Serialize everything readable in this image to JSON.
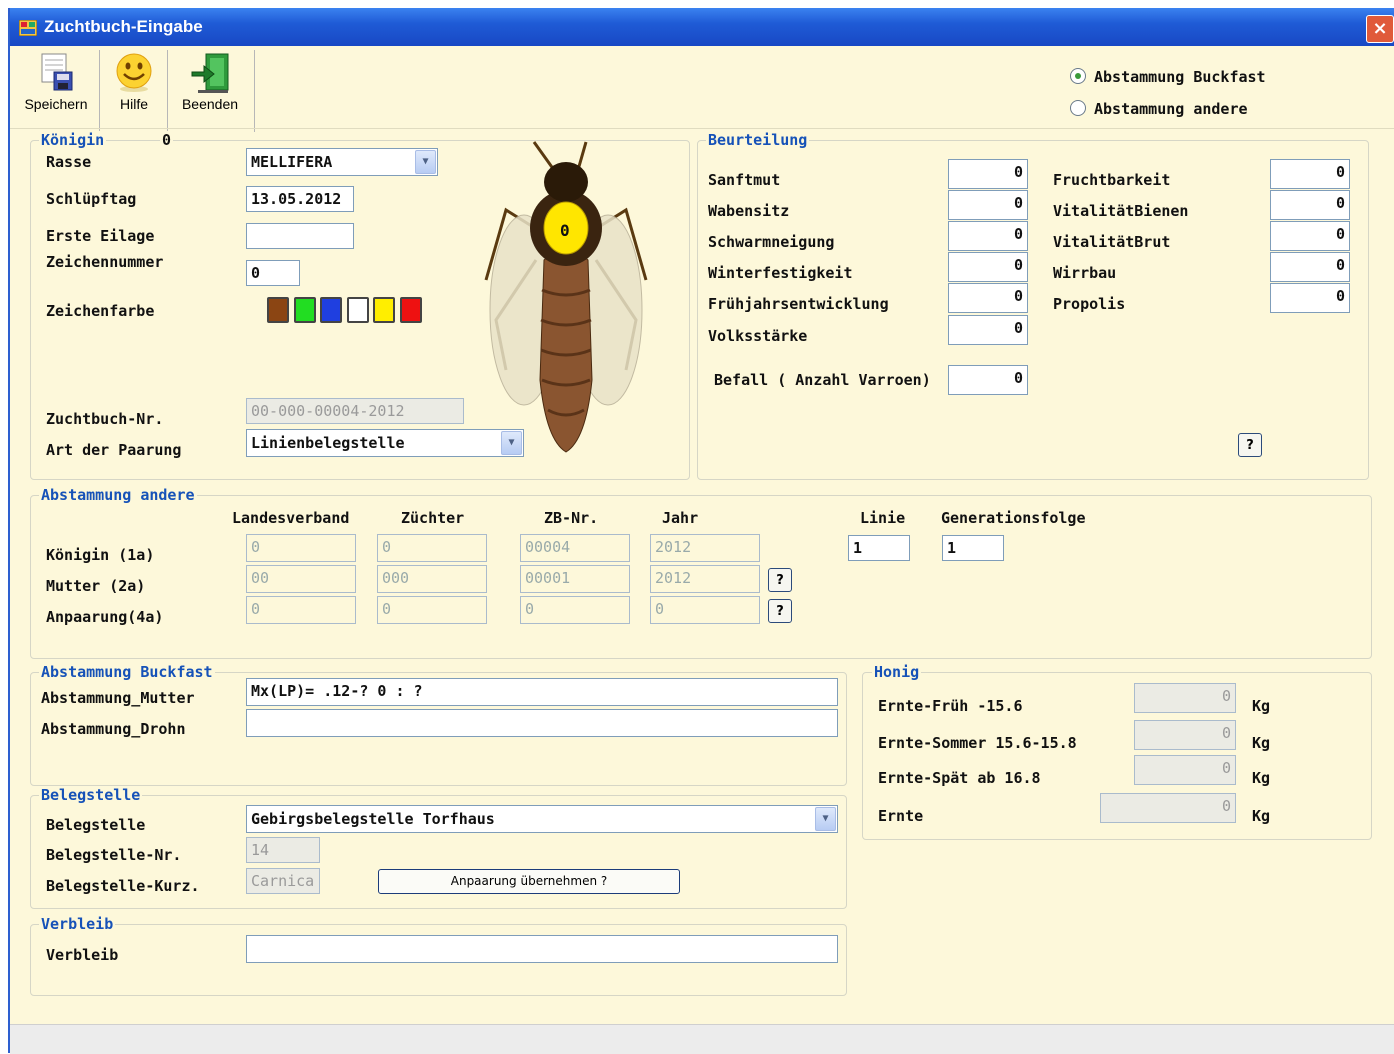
{
  "window": {
    "title": "Zuchtbuch-Eingabe",
    "close": "×"
  },
  "toolbar": {
    "save": "Speichern",
    "help": "Hilfe",
    "exit": "Beenden"
  },
  "abstammung_radio": {
    "buckfast": "Abstammung Buckfast",
    "andere": "Abstammung andere",
    "selected": "buckfast"
  },
  "koenigin": {
    "title": "Königin",
    "count": "0",
    "rasse_label": "Rasse",
    "rasse_value": "MELLIFERA",
    "schluepftag_label": "Schlüpftag",
    "schluepftag_value": "13.05.2012",
    "erste_eilage_label": "Erste Eilage",
    "erste_eilage_value": "",
    "zeichennummer_label": "Zeichennummer",
    "zeichennummer_value": "0",
    "zeichenfarbe_label": "Zeichenfarbe",
    "colors": [
      "#8b4513",
      "#22dd22",
      "#1f3fe0",
      "#ffffff",
      "#ffee00",
      "#ee1111"
    ],
    "zuchtbuch_label": "Zuchtbuch-Nr.",
    "zuchtbuch_value": "00-000-00004-2012",
    "paarung_label": "Art der Paarung",
    "paarung_value": "Linienbelegstelle",
    "bee_mark": "0"
  },
  "beurteilung": {
    "title": "Beurteilung",
    "left": [
      {
        "label": "Sanftmut",
        "value": "0"
      },
      {
        "label": "Wabensitz",
        "value": "0"
      },
      {
        "label": "Schwarmneigung",
        "value": "0"
      },
      {
        "label": "Winterfestigkeit",
        "value": "0"
      },
      {
        "label": "Frühjahrsentwicklung",
        "value": "0"
      },
      {
        "label": "Volksstärke",
        "value": "0"
      }
    ],
    "right": [
      {
        "label": "Fruchtbarkeit",
        "value": "0"
      },
      {
        "label": "VitalitätBienen",
        "value": "0"
      },
      {
        "label": "VitalitätBrut",
        "value": "0"
      },
      {
        "label": "Wirrbau",
        "value": "0"
      },
      {
        "label": "Propolis",
        "value": "0"
      }
    ],
    "befall_label": "Befall ( Anzahl Varroen)",
    "befall_value": "0",
    "help": "?"
  },
  "andere": {
    "title": "Abstammung andere",
    "headers": [
      "Landesverband",
      "Züchter",
      "ZB-Nr.",
      "Jahr",
      "Linie",
      "Generationsfolge"
    ],
    "rows": [
      {
        "label": "Königin (1a)",
        "values": [
          "0",
          "0",
          "00004",
          "2012"
        ]
      },
      {
        "label": "Mutter (2a)",
        "values": [
          "00",
          "000",
          "00001",
          "2012"
        ]
      },
      {
        "label": "Anpaarung(4a)",
        "values": [
          "0",
          "0",
          "0",
          "0"
        ]
      }
    ],
    "linie": "1",
    "generationsfolge": "1",
    "help": "?"
  },
  "buckfast": {
    "title": "Abstammung Buckfast",
    "mutter_label": "Abstammung_Mutter",
    "mutter_value": "Mx(LP)= .12-? 0 : ?",
    "drohn_label": "Abstammung_Drohn",
    "drohn_value": ""
  },
  "honig": {
    "title": "Honig",
    "rows": [
      {
        "label": "Ernte-Früh -15.6",
        "value": "0",
        "unit": "Kg"
      },
      {
        "label": "Ernte-Sommer 15.6-15.8",
        "value": "0",
        "unit": "Kg"
      },
      {
        "label": "Ernte-Spät ab 16.8",
        "value": "0",
        "unit": "Kg"
      },
      {
        "label": "Ernte",
        "value": "0",
        "unit": "Kg"
      }
    ]
  },
  "belegstelle": {
    "title": "Belegstelle",
    "belegstelle_label": "Belegstelle",
    "belegstelle_value": "Gebirgsbelegstelle Torfhaus",
    "nr_label": "Belegstelle-Nr.",
    "nr_value": "14",
    "kurz_label": "Belegstelle-Kurz.",
    "kurz_value": "Carnica",
    "button": "Anpaarung übernehmen ?"
  },
  "verbleib": {
    "title": "Verbleib",
    "label": "Verbleib",
    "value": ""
  }
}
